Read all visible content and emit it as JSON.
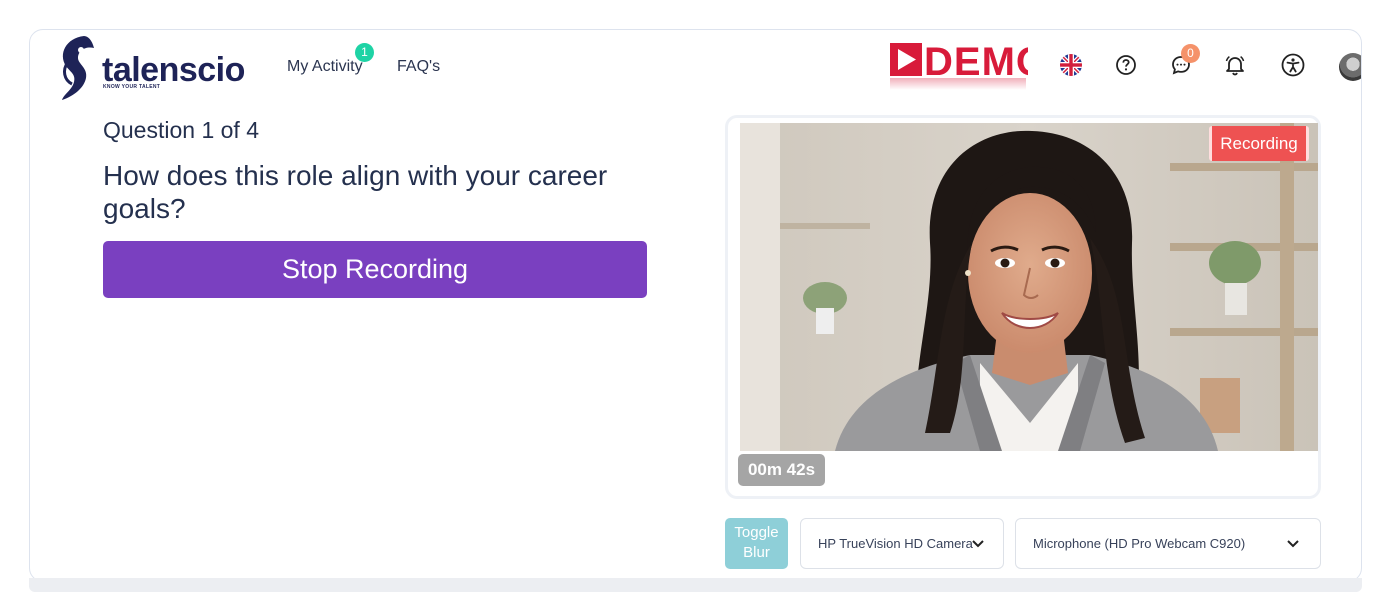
{
  "header": {
    "logo_text": "talenscio",
    "logo_tagline": "KNOW YOUR TALENT",
    "nav": [
      {
        "label": "My Activity",
        "badge": "1"
      },
      {
        "label": "FAQ's"
      }
    ],
    "demo_label": "DEMO",
    "chat_badge": "0",
    "icons": [
      "uk-flag-icon",
      "help-icon",
      "chat-icon",
      "bell-icon",
      "accessibility-icon",
      "avatar"
    ]
  },
  "question": {
    "counter": "Question 1 of 4",
    "text": "How does this role align with your career goals?",
    "stop_button": "Stop Recording"
  },
  "video": {
    "recording_label": "Recording",
    "timer": "00m 42s"
  },
  "controls": {
    "toggle_blur": "Toggle Blur",
    "camera": "HP TrueVision HD Camera",
    "microphone": "Microphone (HD Pro Webcam C920)"
  },
  "colors": {
    "primary": "#7a40c0",
    "brand_navy": "#1e2357",
    "recording": "#ee5252",
    "demo_red": "#d81b3a",
    "activity_badge": "#1ed3a5",
    "chat_badge": "#f5926a",
    "toggle_blur": "#8ecfd8"
  }
}
